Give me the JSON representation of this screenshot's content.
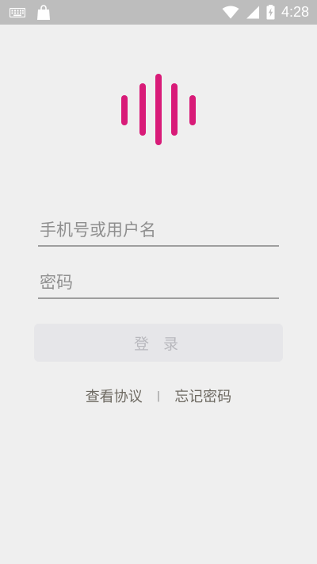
{
  "status_bar": {
    "time": "4:28",
    "left_icons": [
      "keyboard-icon",
      "shopping-bag-icon"
    ],
    "right_icons": [
      "wifi-icon",
      "signal-icon",
      "battery-charging-icon"
    ]
  },
  "logo": {
    "icon": "sound-wave-icon",
    "color": "#d81b78"
  },
  "form": {
    "username_placeholder": "手机号或用户名",
    "username_value": "",
    "password_placeholder": "密码",
    "password_value": "",
    "login_label": "登 录"
  },
  "links": {
    "agreement_label": "查看协议",
    "divider": "|",
    "forgot_password_label": "忘记密码"
  },
  "colors": {
    "background": "#efefef",
    "status_bar": "#bdbdbd",
    "accent": "#d81b78",
    "button_disabled_bg": "#e6e6e9",
    "button_disabled_text": "#b8b8bd",
    "link_text": "#6e6a62"
  }
}
